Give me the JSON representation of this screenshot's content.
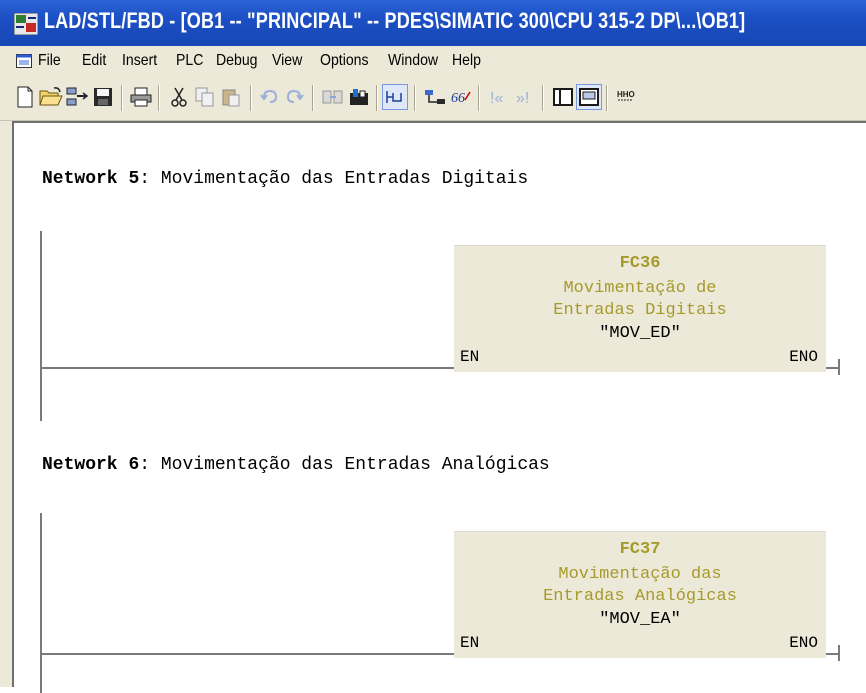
{
  "window": {
    "title": "LAD/STL/FBD  - [OB1 -- \"PRINCIPAL\" -- PDES\\SIMATIC 300\\CPU 315-2 DP\\...\\OB1]"
  },
  "menu": {
    "items": [
      {
        "label": "File"
      },
      {
        "label": "Edit"
      },
      {
        "label": "Insert"
      },
      {
        "label": "PLC"
      },
      {
        "label": "Debug"
      },
      {
        "label": "View"
      },
      {
        "label": "Options"
      },
      {
        "label": "Window"
      },
      {
        "label": "Help"
      }
    ]
  },
  "toolbar": {
    "buttons": [
      {
        "icon": "new-icon"
      },
      {
        "icon": "open-icon"
      },
      {
        "icon": "accessible-nodes-icon"
      },
      {
        "icon": "save-icon"
      },
      {
        "icon": "print-icon"
      },
      {
        "icon": "cut-icon"
      },
      {
        "icon": "copy-icon"
      },
      {
        "icon": "paste-icon"
      },
      {
        "icon": "undo-icon"
      },
      {
        "icon": "redo-icon"
      },
      {
        "icon": "download-icon"
      },
      {
        "icon": "upload-icon"
      },
      {
        "icon": "ladder-view-icon"
      },
      {
        "icon": "network-icon"
      },
      {
        "icon": "monitor-icon"
      },
      {
        "icon": "previous-icon"
      },
      {
        "icon": "next-icon"
      },
      {
        "icon": "overview-icon"
      },
      {
        "icon": "details-icon"
      },
      {
        "icon": "more-icon"
      }
    ]
  },
  "networks": [
    {
      "label": "Network",
      "number": "5",
      "separator": ":",
      "comment": "Movimentação das Entradas Digitais",
      "block": {
        "name": "FC36",
        "description_line1": "Movimentação de",
        "description_line2": "Entradas Digitais",
        "symbol": "\"MOV_ED\"",
        "input_pin": "EN",
        "output_pin": "ENO"
      }
    },
    {
      "label": "Network",
      "number": "6",
      "separator": ":",
      "comment": "Movimentação das Entradas Analógicas",
      "block": {
        "name": "FC37",
        "description_line1": "Movimentação das",
        "description_line2": "Entradas Analógicas",
        "symbol": "\"MOV_EA\"",
        "input_pin": "EN",
        "output_pin": "ENO"
      }
    }
  ],
  "colors": {
    "titlebar": "#1c4fc4",
    "block_fill": "#ece9d8",
    "block_text": "#a69a2d"
  }
}
